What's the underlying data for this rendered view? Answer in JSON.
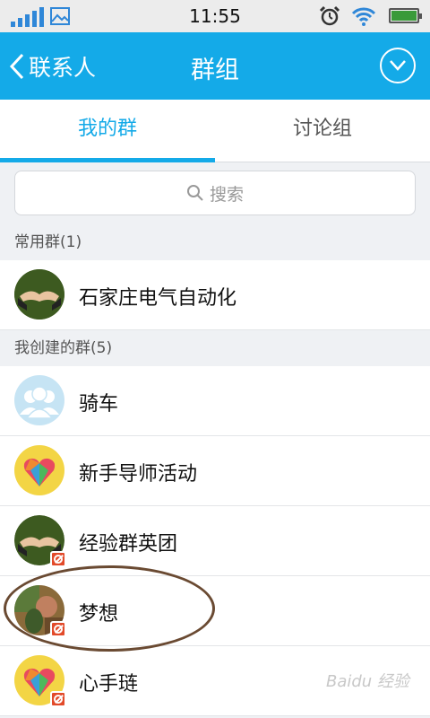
{
  "status_bar": {
    "time": "11:55",
    "icons": [
      "signal-icon",
      "image-icon",
      "alarm-icon",
      "wifi-icon",
      "battery-icon"
    ]
  },
  "nav": {
    "back_label": "联系人",
    "title": "群组"
  },
  "tabs": [
    {
      "label": "我的群",
      "active": true
    },
    {
      "label": "讨论组",
      "active": false
    }
  ],
  "search": {
    "placeholder": "搜索"
  },
  "sections": [
    {
      "header": "常用群(1)",
      "groups": [
        {
          "name": "石家庄电气自动化",
          "avatar": "handshake",
          "restricted": false
        }
      ]
    },
    {
      "header": "我创建的群(5)",
      "groups": [
        {
          "name": "骑车",
          "avatar": "people",
          "restricted": false
        },
        {
          "name": "新手导师活动",
          "avatar": "heart",
          "restricted": false
        },
        {
          "name": "经验群英团",
          "avatar": "handshake",
          "restricted": true
        },
        {
          "name": "梦想",
          "avatar": "photo",
          "restricted": true
        },
        {
          "name": "心手琏",
          "avatar": "heart",
          "restricted": true
        }
      ]
    }
  ],
  "watermark": "Baidu 经验",
  "colors": {
    "accent": "#14aae8",
    "badge": "#e24a2a"
  }
}
